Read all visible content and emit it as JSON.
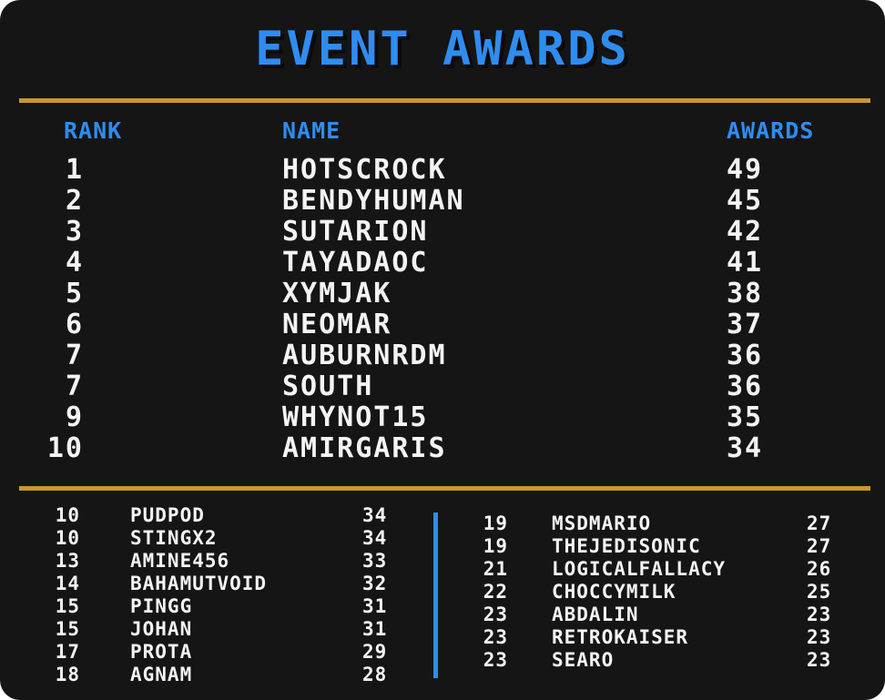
{
  "title": "EVENT AWARDS",
  "headers": {
    "rank": "RANK",
    "name": "NAME",
    "awards": "AWARDS"
  },
  "top": [
    {
      "rank": "1",
      "name": "HOTSCROCK",
      "awards": "49"
    },
    {
      "rank": "2",
      "name": "BENDYHUMAN",
      "awards": "45"
    },
    {
      "rank": "3",
      "name": "SUTARION",
      "awards": "42"
    },
    {
      "rank": "4",
      "name": "TAYADAOC",
      "awards": "41"
    },
    {
      "rank": "5",
      "name": "XYMJAK",
      "awards": "38"
    },
    {
      "rank": "6",
      "name": "NEOMAR",
      "awards": "37"
    },
    {
      "rank": "7",
      "name": "AUBURNRDM",
      "awards": "36"
    },
    {
      "rank": "7",
      "name": "SOUTH",
      "awards": "36"
    },
    {
      "rank": "9",
      "name": "WHYNOT15",
      "awards": "35"
    },
    {
      "rank": "10",
      "name": "AMIRGARIS",
      "awards": "34"
    }
  ],
  "left_list": [
    {
      "rank": "10",
      "name": "PUDPOD",
      "awards": "34"
    },
    {
      "rank": "10",
      "name": "STINGX2",
      "awards": "34"
    },
    {
      "rank": "13",
      "name": "AMINE456",
      "awards": "33"
    },
    {
      "rank": "14",
      "name": "BAHAMUTVOID",
      "awards": "32"
    },
    {
      "rank": "15",
      "name": "PINGG",
      "awards": "31"
    },
    {
      "rank": "15",
      "name": "JOHAN",
      "awards": "31"
    },
    {
      "rank": "17",
      "name": "PROTA",
      "awards": "29"
    },
    {
      "rank": "18",
      "name": "AGNAM",
      "awards": "28"
    }
  ],
  "right_list": [
    {
      "rank": "19",
      "name": "MSDMARIO",
      "awards": "27"
    },
    {
      "rank": "19",
      "name": "THEJEDISONIC",
      "awards": "27"
    },
    {
      "rank": "21",
      "name": "LOGICALFALLACY",
      "awards": "26"
    },
    {
      "rank": "22",
      "name": "CHOCCYMILK",
      "awards": "25"
    },
    {
      "rank": "23",
      "name": "ABDALIN",
      "awards": "23"
    },
    {
      "rank": "23",
      "name": "RETROKAISER",
      "awards": "23"
    },
    {
      "rank": "23",
      "name": "SEARO",
      "awards": "23"
    }
  ],
  "colors": {
    "background": "#151515",
    "title_blue": "#2f8cf0",
    "gold_rule": "#c9962c",
    "text": "#f4f4f4"
  }
}
